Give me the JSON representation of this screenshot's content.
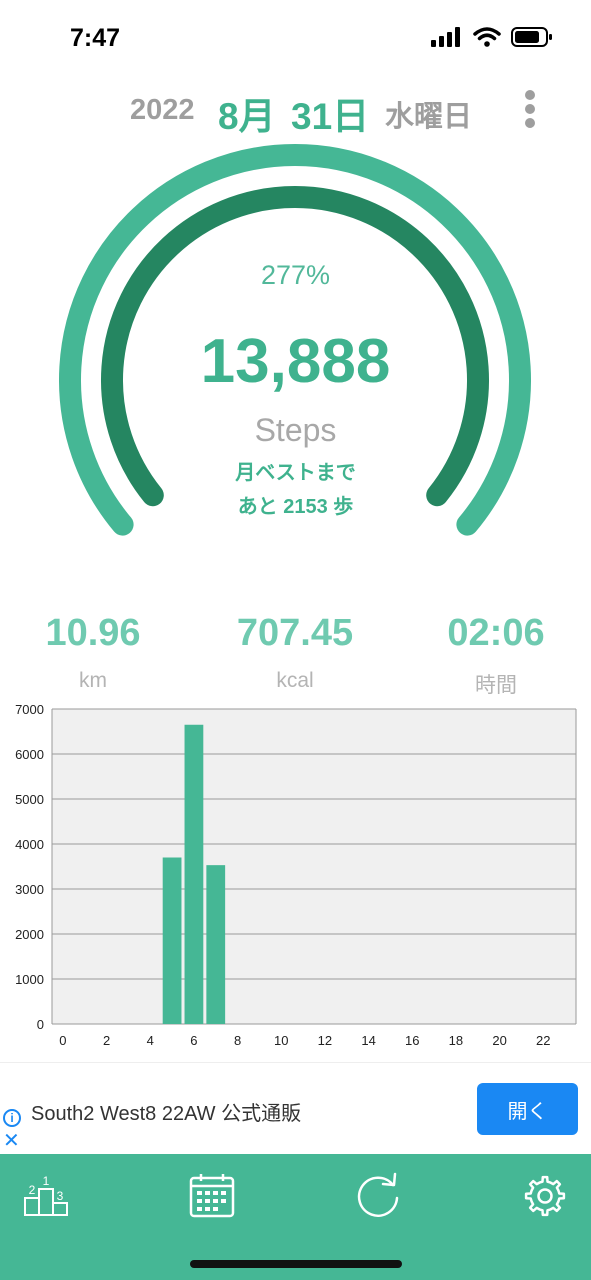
{
  "status": {
    "time": "7:47"
  },
  "date": {
    "year": "2022",
    "month": "8月",
    "day": "31日",
    "weekday": "水曜日"
  },
  "summary": {
    "percent": "277%",
    "steps": "13,888",
    "steps_label": "Steps",
    "best_line1": "月ベストまで",
    "best_line2": "あと 2153 歩",
    "progress_fraction": 1.0,
    "month_best_fraction": 1.0
  },
  "stats": [
    {
      "value": "10.96",
      "unit": "km"
    },
    {
      "value": "707.45",
      "unit": "kcal"
    },
    {
      "value": "02:06",
      "unit": "時間"
    }
  ],
  "chart_data": {
    "type": "bar",
    "x": [
      0,
      1,
      2,
      3,
      4,
      5,
      6,
      7,
      8,
      9,
      10,
      11,
      12,
      13,
      14,
      15,
      16,
      17,
      18,
      19,
      20,
      21,
      22,
      23
    ],
    "values": [
      0,
      0,
      0,
      0,
      0,
      3700,
      6650,
      3530,
      0,
      0,
      0,
      0,
      0,
      0,
      0,
      0,
      0,
      0,
      0,
      0,
      0,
      0,
      0,
      0
    ],
    "x_ticks": [
      "0",
      "2",
      "4",
      "6",
      "8",
      "10",
      "12",
      "14",
      "16",
      "18",
      "20",
      "22"
    ],
    "y_ticks": [
      "0",
      "1000",
      "2000",
      "3000",
      "4000",
      "5000",
      "6000",
      "7000"
    ],
    "ylim": [
      0,
      7000
    ],
    "grid": true,
    "bar_color": "#45b795",
    "background": "#f0f0f0"
  },
  "ad": {
    "text": "South2 West8 22AW 公式通販",
    "button": "開く"
  },
  "tabs": [
    {
      "icon": "ranking-icon"
    },
    {
      "icon": "calendar-icon"
    },
    {
      "icon": "refresh-icon"
    },
    {
      "icon": "gear-icon"
    }
  ],
  "colors": {
    "accent": "#3fb28e",
    "outer_ring": "#45b795",
    "inner_ring": "#258661",
    "tabbar": "#45b795",
    "ad_button": "#1a88f3"
  }
}
